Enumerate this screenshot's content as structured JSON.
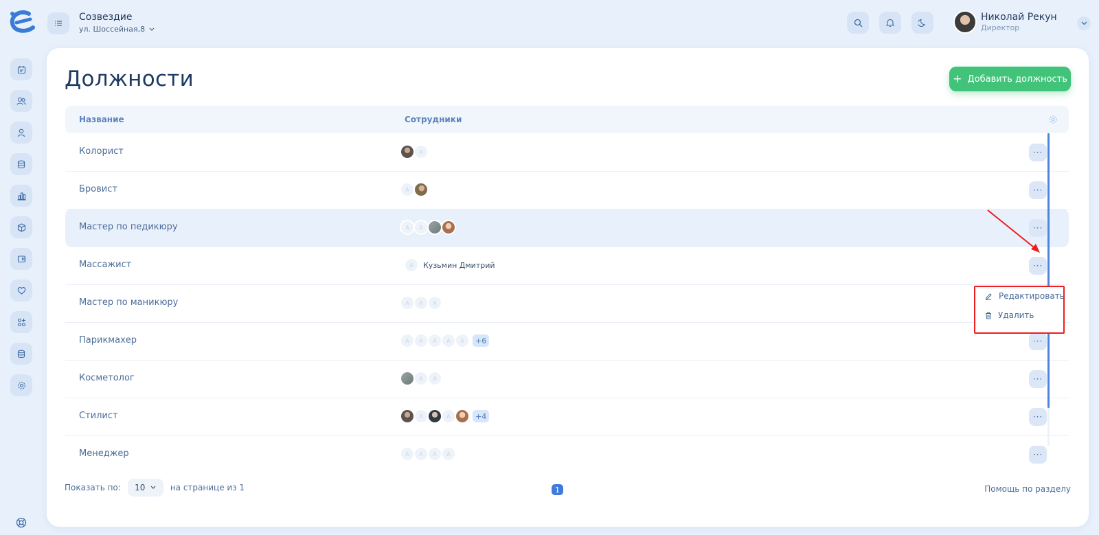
{
  "header": {
    "org_name": "Созвездие",
    "org_address": "ул. Шоссейная,8",
    "user_name": "Николай Рекун",
    "user_role": "Директор"
  },
  "page": {
    "title": "Должности",
    "add_button": "Добавить должность"
  },
  "table": {
    "columns": [
      "Название",
      "Сотрудники"
    ],
    "rows": [
      {
        "name": "Колорист",
        "extra": ""
      },
      {
        "name": "Бровист",
        "extra": ""
      },
      {
        "name": "Мастер по педикюру",
        "extra": ""
      },
      {
        "name": "Массажист",
        "extra": "Кузьмин Дмитрий"
      },
      {
        "name": "Мастер по маникюру",
        "extra": ""
      },
      {
        "name": "Парикмахер",
        "extra": "+6"
      },
      {
        "name": "Косметолог",
        "extra": ""
      },
      {
        "name": "Стилист",
        "extra": "+4"
      },
      {
        "name": "Менеджер",
        "extra": ""
      }
    ]
  },
  "context_menu": {
    "edit": "Редактировать",
    "delete": "Удалить"
  },
  "footer": {
    "show_label": "Показать по:",
    "per_page": "10",
    "pages_label": "на странице из 1",
    "current_page": "1",
    "help": "Помощь по разделу"
  },
  "colors": {
    "accent": "#3f7bde",
    "primary_button": "#42c37a",
    "annotation": "#ee1c1c"
  }
}
